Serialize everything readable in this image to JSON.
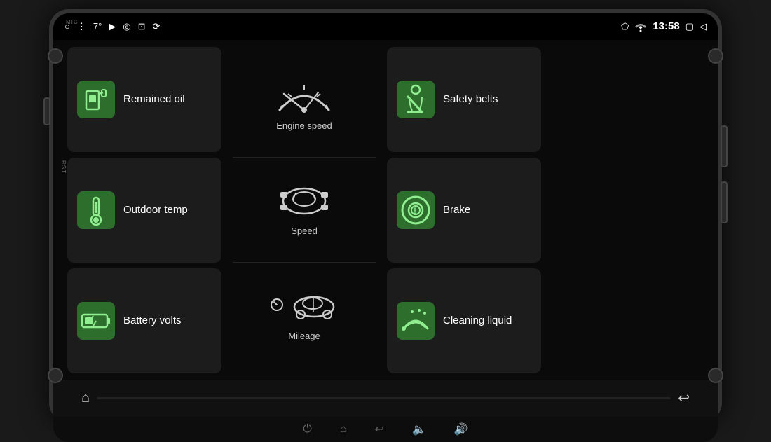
{
  "device": {
    "mic_label": "MIC",
    "rst_label": "RST"
  },
  "status_bar": {
    "temp": "7°",
    "time": "13:58",
    "icons": [
      "○",
      "⋮",
      "▶",
      "◎",
      "📷",
      "🔄"
    ]
  },
  "cards": [
    {
      "id": "remained-oil",
      "label": "Remained oil",
      "icon_type": "fuel",
      "col": 1,
      "row": 1
    },
    {
      "id": "outdoor-temp",
      "label": "Outdoor temp",
      "icon_type": "thermometer",
      "col": 1,
      "row": 2
    },
    {
      "id": "battery-volts",
      "label": "Battery volts",
      "icon_type": "battery",
      "col": 1,
      "row": 3
    },
    {
      "id": "safety-belts",
      "label": "Safety belts",
      "icon_type": "seatbelt",
      "col": 3,
      "row": 1
    },
    {
      "id": "brake",
      "label": "Brake",
      "icon_type": "brake",
      "col": 3,
      "row": 2
    },
    {
      "id": "cleaning-liquid",
      "label": "Cleaning liquid",
      "icon_type": "wiper",
      "col": 3,
      "row": 3
    }
  ],
  "center_sections": [
    {
      "id": "engine-speed",
      "label": "Engine speed",
      "icon_type": "gauge"
    },
    {
      "id": "speed",
      "label": "Speed",
      "icon_type": "car"
    },
    {
      "id": "mileage",
      "label": "Mileage",
      "icon_type": "car-warning"
    }
  ],
  "bottom_bar": {
    "home_icon": "⌂",
    "back_icon": "↩"
  },
  "physical_bar": {
    "power_icon": "⏻",
    "home_icon": "⌂",
    "back_icon": "↩",
    "vol_down_icon": "🔈",
    "vol_up_icon": "🔊"
  }
}
